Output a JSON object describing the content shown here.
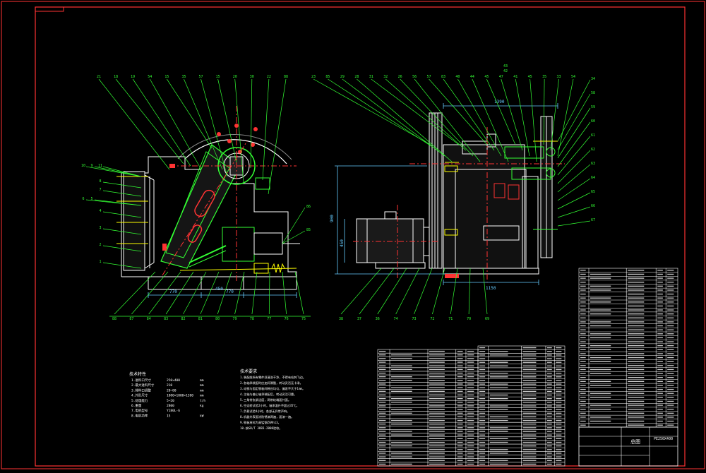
{
  "drawing": {
    "title_block": {
      "name": "总图",
      "code": "PE250X400"
    },
    "colors": {
      "background": "#000000",
      "frame": "#ff3333",
      "primary_lines": "#ffffff",
      "leader_lines": "#33ff33",
      "center_lines": "#ff3333",
      "dimension_lines": "#66ccff",
      "highlight": "#ffff00",
      "part_fill": "#1a1a1a"
    },
    "front_view_balloons_top": [
      "21",
      "18",
      "19",
      "54",
      "15",
      "35",
      "57",
      "15",
      "20",
      "30",
      "22",
      "88"
    ],
    "side_view_balloons_top": [
      "23",
      "85",
      "29",
      "28",
      "31",
      "32",
      "26",
      "56",
      "57",
      "83",
      "40",
      "44",
      "45",
      "47",
      "41",
      "45",
      "35",
      "33",
      "54"
    ],
    "side_view_balloons_top_extra": [
      "43",
      "42"
    ],
    "left_balloons": [
      "10",
      "9",
      "11",
      "8",
      "7",
      "6",
      "5",
      "4",
      "3",
      "2",
      "1"
    ],
    "bottom_front_balloons": [
      "88",
      "87",
      "84",
      "83",
      "82",
      "81",
      "80",
      "79",
      "78",
      "77",
      "76",
      "75"
    ],
    "bottom_side_balloons": [
      "38",
      "37",
      "36",
      "74",
      "73",
      "72",
      "71",
      "70",
      "69"
    ],
    "right_balloons": [
      "34",
      "58",
      "59",
      "60",
      "61",
      "62",
      "63",
      "64",
      "65",
      "66",
      "67"
    ],
    "front_view_right_balloons": [
      "86",
      "85"
    ],
    "tech_notes_title": "技术特性",
    "tech_specs": [
      {
        "label": "1.进料口尺寸",
        "value": "250×400",
        "unit": "mm"
      },
      {
        "label": "2.最大进料尺寸",
        "value": "210",
        "unit": "mm"
      },
      {
        "label": "3.排料口调整",
        "value": "20~80",
        "unit": "mm"
      },
      {
        "label": "4.外形尺寸",
        "value": "1080×1000×1200",
        "unit": "mm"
      },
      {
        "label": "5.处理能力",
        "value": "5~20",
        "unit": "t/h"
      },
      {
        "label": "6.重量",
        "value": "2800",
        "unit": "kg"
      },
      {
        "label": "7.电机型号",
        "value": "Y180L-6",
        "unit": ""
      },
      {
        "label": "8.电机功率",
        "value": "15",
        "unit": "kW"
      }
    ],
    "requirements_title": "技术要求",
    "requirements": [
      "1.装配前所有零件须清洗干净，不得有毛刺飞边。",
      "2.各轴承装配时应加润滑脂，转动灵活无卡滞。",
      "3.动颚与固定颚板间隙应均匀，偏差不大于1mm。",
      "4.主轴与偏心轴承装配后，转动灵活可靠。",
      "5.三角带张紧适度，两带轮端面共面。",
      "6.空运转试验2小时，轴承温升不超过35℃。",
      "7.负载试验4小时，各部无异常声响。",
      "8.机器外表面涂防锈漆两遍，面漆一遍。",
      "  9.颚板材料为高锰钢ZGMn13。",
      "  10.按GB/T 3883-2008验收。"
    ],
    "dims": {
      "front_w1": "770",
      "front_w2": "450",
      "front_w3": "770",
      "side_w": "1200",
      "side_h": "900",
      "side_bottom": "1150",
      "motor_h": "450",
      "side_top": "1390"
    }
  }
}
